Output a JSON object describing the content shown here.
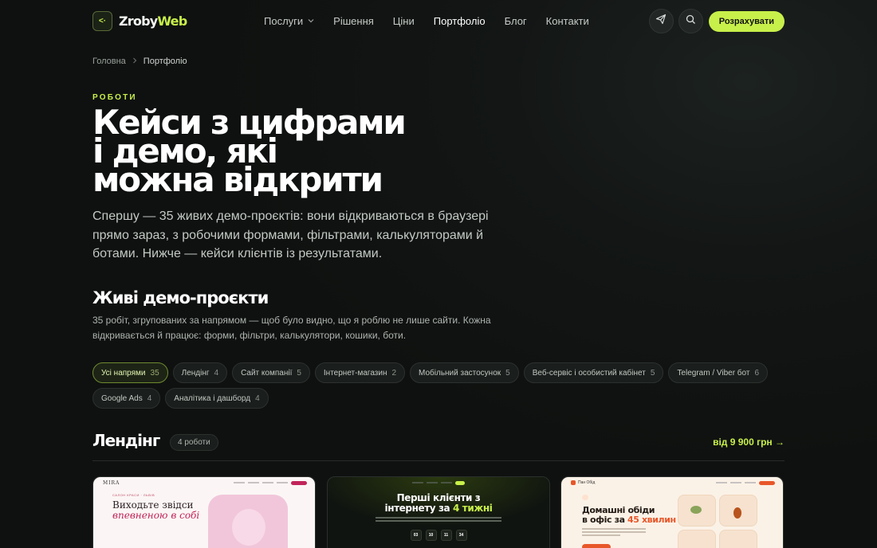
{
  "header": {
    "logo_mark": "<·",
    "logo_main": "Zroby",
    "logo_accent": "Web",
    "nav": [
      {
        "label": "Послуги"
      },
      {
        "label": "Рішення"
      },
      {
        "label": "Ціни"
      },
      {
        "label": "Портфоліо"
      },
      {
        "label": "Блог"
      },
      {
        "label": "Контакти"
      }
    ],
    "active_nav": "Портфоліо",
    "cta_label": "Розрахувати"
  },
  "breadcrumb": {
    "home": "Головна",
    "current": "Портфоліо"
  },
  "hero": {
    "eyebrow": "РОБОТИ",
    "title_lines": [
      "Кейси з цифрами",
      "і демо, які",
      "можна відкрити"
    ],
    "description": "Спершу — 35 живих демо-проєктів: вони відкриваються в браузері прямо зараз, з робочими формами, фільтрами, калькуляторами й ботами. Нижче — кейси клієнтів із результатами."
  },
  "demos": {
    "title": "Живі демо-проєкти",
    "description": "35 робіт, згрупованих за напрямом — щоб було видно, що я роблю не лише сайти. Кожна відкривається й працює: форми, фільтри, калькулятори, кошики, боти.",
    "filters": [
      {
        "label": "Усі напрями",
        "count": "35"
      },
      {
        "label": "Лендінг",
        "count": "4"
      },
      {
        "label": "Сайт компанії",
        "count": "5"
      },
      {
        "label": "Інтернет-магазин",
        "count": "2"
      },
      {
        "label": "Мобільний застосунок",
        "count": "5"
      },
      {
        "label": "Веб-сервіс і особистий кабінет",
        "count": "5"
      },
      {
        "label": "Telegram / Viber бот",
        "count": "6"
      },
      {
        "label": "Google Ads",
        "count": "4"
      },
      {
        "label": "Аналітика і дашборд",
        "count": "4"
      }
    ],
    "active_filter": "Усі напрями"
  },
  "group": {
    "title": "Лендінг",
    "count_label": "4 роботи",
    "price_link": "від 9 900 грн →"
  },
  "cards": [
    {
      "logo": "MIRA",
      "kicker": "САЛОН КРАСИ · ЛЬВІВ",
      "heading_line1": "Виходьте звідси",
      "heading_line2": "впевненою в собі"
    },
    {
      "heading_part1": "Перші клієнти з",
      "heading_part2": "інтернету за ",
      "heading_accent": "4 тижні",
      "timer": [
        "03",
        "10",
        "11",
        "34"
      ]
    },
    {
      "logo": "Пан Обід",
      "heading_part1": "Домашні обіди",
      "heading_part2": "в офіс за ",
      "heading_accent": "45 хвилин"
    }
  ],
  "colors": {
    "accent": "#c8f04a",
    "background": "#131615",
    "card1_accent": "#c2245a",
    "card3_accent": "#e8572a"
  },
  "icons": {
    "telegram": "paper-plane-icon",
    "search": "search-icon",
    "chevron": "chevron-down-icon",
    "breadcrumb_sep": "chevron-right-icon"
  }
}
